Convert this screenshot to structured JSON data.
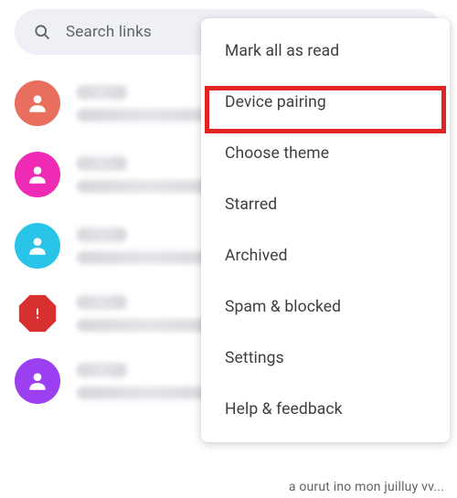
{
  "search": {
    "placeholder": "Search links"
  },
  "conversations": [
    {
      "avatarColor": "#e86f5e",
      "avatarType": "person"
    },
    {
      "avatarColor": "#ef2ab4",
      "avatarType": "person"
    },
    {
      "avatarColor": "#29c4e8",
      "avatarType": "person"
    },
    {
      "avatarColor": "#d82f2f",
      "avatarType": "warning"
    },
    {
      "avatarColor": "#9b3ff0",
      "avatarType": "person"
    }
  ],
  "menu": {
    "items": [
      {
        "label": "Mark all as read"
      },
      {
        "label": "Device pairing",
        "highlighted": true
      },
      {
        "label": "Choose theme"
      },
      {
        "label": "Starred"
      },
      {
        "label": "Archived"
      },
      {
        "label": "Spam & blocked"
      },
      {
        "label": "Settings"
      },
      {
        "label": "Help & feedback"
      }
    ]
  },
  "footer": {
    "snippet": "a ourut ino mon juilluy vv..."
  }
}
